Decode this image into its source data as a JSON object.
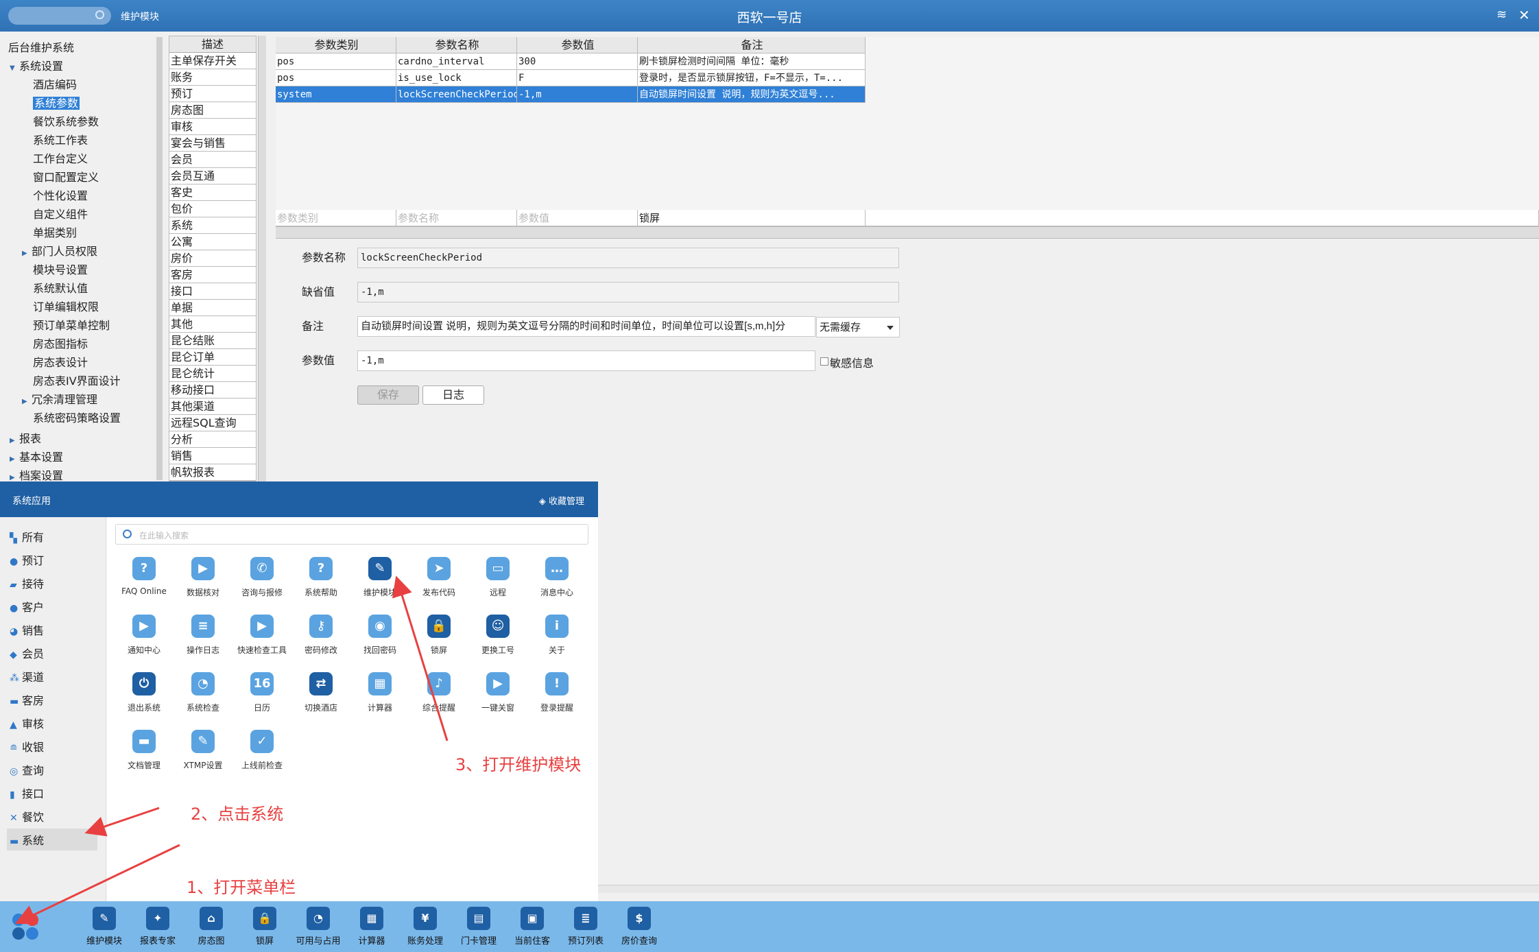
{
  "window": {
    "search_placeholder": "",
    "module_title": "维护模块",
    "store_title": "西软一号店"
  },
  "tree": {
    "root": "后台维护系统",
    "system_settings": "系统设置",
    "items": [
      "酒店编码",
      "系统参数",
      "餐饮系统参数",
      "系统工作表",
      "工作台定义",
      "窗口配置定义",
      "个性化设置",
      "自定义组件",
      "单据类别",
      "部门人员权限",
      "模块号设置",
      "系统默认值",
      "订单编辑权限",
      "预订单菜单控制",
      "房态图指标",
      "房态表设计",
      "房态表IV界面设计",
      "冗余清理管理",
      "系统密码策略设置"
    ],
    "top_items": [
      "报表",
      "基本设置",
      "档案设置"
    ]
  },
  "desc_list": {
    "header": "描述",
    "items": [
      "主单保存开关",
      "账务",
      "预订",
      "房态图",
      "审核",
      "宴会与销售",
      "会员",
      "会员互通",
      "客史",
      "包价",
      "系统",
      "公寓",
      "房价",
      "客房",
      "接口",
      "单据",
      "其他",
      "昆仑结账",
      "昆仑订单",
      "昆仑统计",
      "移动接口",
      "其他渠道",
      "远程SQL查询",
      "分析",
      "销售",
      "帆软报表"
    ]
  },
  "grid": {
    "headers": [
      "参数类别",
      "参数名称",
      "参数值",
      "备注"
    ],
    "rows": [
      [
        "pos",
        "cardno_interval",
        "300",
        "刷卡锁屏检测时间间隔 单位：毫秒"
      ],
      [
        "pos",
        "is_use_lock",
        "F",
        "登录时，是否显示锁屏按钮，F=不显示，T=..."
      ],
      [
        "system",
        "lockScreenCheckPeriod",
        "-1,m",
        "自动锁屏时间设置 说明，规则为英文逗号..."
      ]
    ],
    "filters": [
      "参数类别",
      "参数名称",
      "参数值",
      "锁屏"
    ]
  },
  "form": {
    "name_label": "参数名称",
    "name_value": "lockScreenCheckPeriod",
    "default_label": "缺省值",
    "default_value": "-1,m",
    "note_label": "备注",
    "note_value": "自动锁屏时间设置 说明，规则为英文逗号分隔的时间和时间单位，时间单位可以设置[s,m,h]分",
    "cache_option": "无需缓存",
    "value_label": "参数值",
    "value_value": "-1,m",
    "sensitive_label": "敏感信息",
    "save_button": "保存",
    "log_button": "日志"
  },
  "popup": {
    "title": "系统应用",
    "favorites": "收藏管理",
    "search_placeholder": "在此输入搜索",
    "categories": [
      {
        "icon": "grid-icon",
        "label": "所有"
      },
      {
        "icon": "booking-icon",
        "label": "预订"
      },
      {
        "icon": "chat-icon",
        "label": "接待"
      },
      {
        "icon": "user-icon",
        "label": "客户"
      },
      {
        "icon": "pie-icon",
        "label": "销售"
      },
      {
        "icon": "diamond-icon",
        "label": "会员"
      },
      {
        "icon": "channel-icon",
        "label": "渠道"
      },
      {
        "icon": "bed-icon",
        "label": "客房"
      },
      {
        "icon": "stamp-icon",
        "label": "审核"
      },
      {
        "icon": "coins-icon",
        "label": "收银"
      },
      {
        "icon": "search-icon",
        "label": "查询"
      },
      {
        "icon": "plug-icon",
        "label": "接口"
      },
      {
        "icon": "dining-icon",
        "label": "餐饮"
      },
      {
        "icon": "system-icon",
        "label": "系统"
      }
    ],
    "apps": [
      {
        "label": "FAQ Online",
        "glyph": "?"
      },
      {
        "label": "数据核对",
        "glyph": "▶"
      },
      {
        "label": "咨询与报修",
        "glyph": "✆"
      },
      {
        "label": "系统帮助",
        "glyph": "?"
      },
      {
        "label": "维护模块",
        "glyph": "✎"
      },
      {
        "label": "发布代码",
        "glyph": "➤"
      },
      {
        "label": "远程",
        "glyph": "▭"
      },
      {
        "label": "消息中心",
        "glyph": "…"
      },
      {
        "label": "通知中心",
        "glyph": "▶"
      },
      {
        "label": "操作日志",
        "glyph": "≡"
      },
      {
        "label": "快速检查工具",
        "glyph": "▶"
      },
      {
        "label": "密码修改",
        "glyph": "⚷"
      },
      {
        "label": "找回密码",
        "glyph": "◉"
      },
      {
        "label": "锁屏",
        "glyph": "🔒"
      },
      {
        "label": "更换工号",
        "glyph": "☺"
      },
      {
        "label": "关于",
        "glyph": "i"
      },
      {
        "label": "退出系统",
        "glyph": "⏻"
      },
      {
        "label": "系统检查",
        "glyph": "◔"
      },
      {
        "label": "日历",
        "glyph": "16"
      },
      {
        "label": "切换酒店",
        "glyph": "⇄"
      },
      {
        "label": "计算器",
        "glyph": "▦"
      },
      {
        "label": "综合提醒",
        "glyph": "♪"
      },
      {
        "label": "一键关窗",
        "glyph": "▶"
      },
      {
        "label": "登录提醒",
        "glyph": "!"
      },
      {
        "label": "文档管理",
        "glyph": "▬"
      },
      {
        "label": "XTMP设置",
        "glyph": "✎"
      },
      {
        "label": "上线前检查",
        "glyph": "✓"
      }
    ]
  },
  "taskbar": {
    "items": [
      {
        "label": "维护模块",
        "glyph": "✎"
      },
      {
        "label": "报表专家",
        "glyph": "✦"
      },
      {
        "label": "房态图",
        "glyph": "⌂"
      },
      {
        "label": "锁屏",
        "glyph": "🔒"
      },
      {
        "label": "可用与占用",
        "glyph": "◔"
      },
      {
        "label": "计算器",
        "glyph": "▦"
      },
      {
        "label": "账务处理",
        "glyph": "¥"
      },
      {
        "label": "门卡管理",
        "glyph": "▤"
      },
      {
        "label": "当前住客",
        "glyph": "▣"
      },
      {
        "label": "预订列表",
        "glyph": "≣"
      },
      {
        "label": "房价查询",
        "glyph": "$"
      }
    ]
  },
  "annotations": {
    "step1": "1、打开菜单栏",
    "step2": "2、点击系统",
    "step3": "3、打开维护模块"
  },
  "colors": {
    "accent": "#2f80d6",
    "title_bar": "#2f72b5",
    "popup_header": "#1f5fa3",
    "taskbar": "#7ab8ea",
    "annotation": "#e84040"
  }
}
